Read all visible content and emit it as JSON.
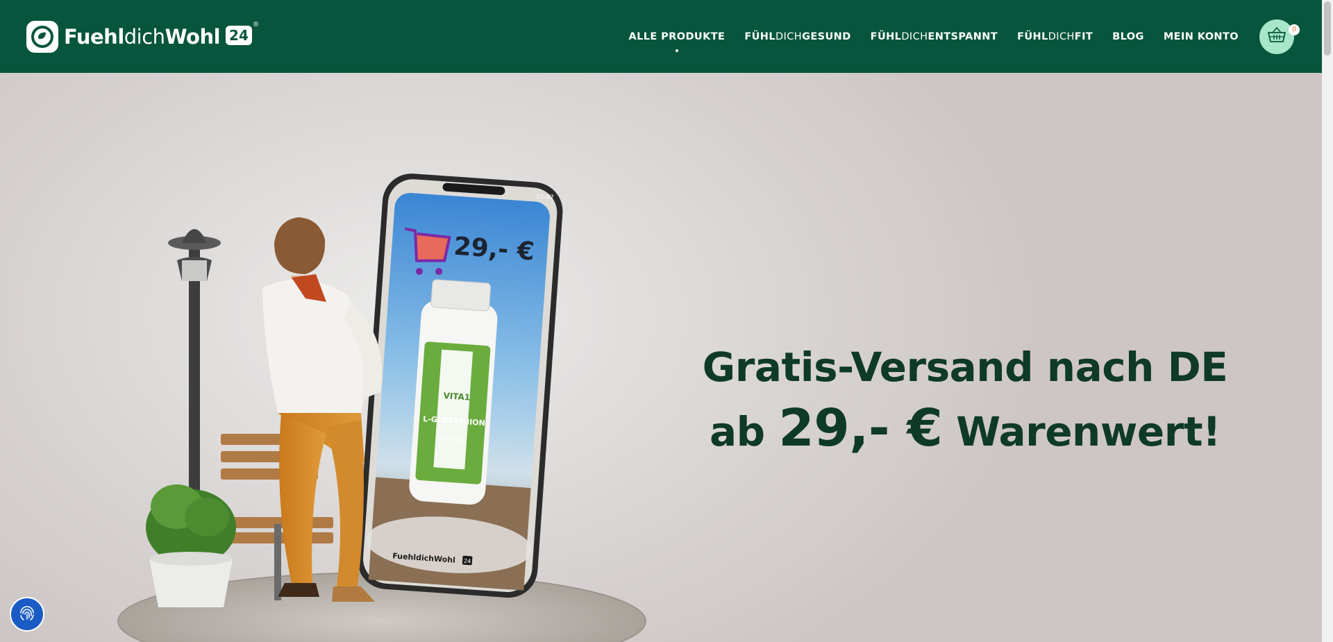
{
  "brand": {
    "name_bold_1": "Fuehl",
    "name_light": "dich",
    "name_bold_2": "Wohl",
    "badge": "24",
    "registered": "®",
    "logo_icon": "leaf-cup-icon"
  },
  "nav": {
    "items": [
      {
        "label": "ALLE PRODUKTE",
        "active": true
      },
      {
        "pre": "FÜHL",
        "mid": "DICH",
        "post": "GESUND"
      },
      {
        "pre": "FÜHL",
        "mid": "DICH",
        "post": "ENTSPANNT"
      },
      {
        "pre": "FÜHL",
        "mid": "DICH",
        "post": "FIT"
      },
      {
        "label": "BLOG"
      },
      {
        "label": "MEIN KONTO"
      }
    ],
    "cart_icon": "basket-icon",
    "cart_count": "0"
  },
  "hero": {
    "headline_line1": "Gratis-Versand nach DE",
    "headline_ab": "ab",
    "headline_price": "29,- €",
    "headline_rest": "Warenwert!",
    "phone_price": "29,- €",
    "phone_time": "12:47",
    "bottle_brand": "VITA1",
    "bottle_product": "L-GLUTATHION",
    "bottle_dose": "500 mg",
    "phone_logo_text": "FuehldichWohl",
    "phone_logo_badge": "24"
  },
  "floating_button": {
    "icon": "fingerprint-icon"
  },
  "colors": {
    "header_bg": "#07553c",
    "headline": "#0e3a27",
    "cart_bg": "#a7e6c8",
    "fab_bg": "#1a5bc4"
  }
}
